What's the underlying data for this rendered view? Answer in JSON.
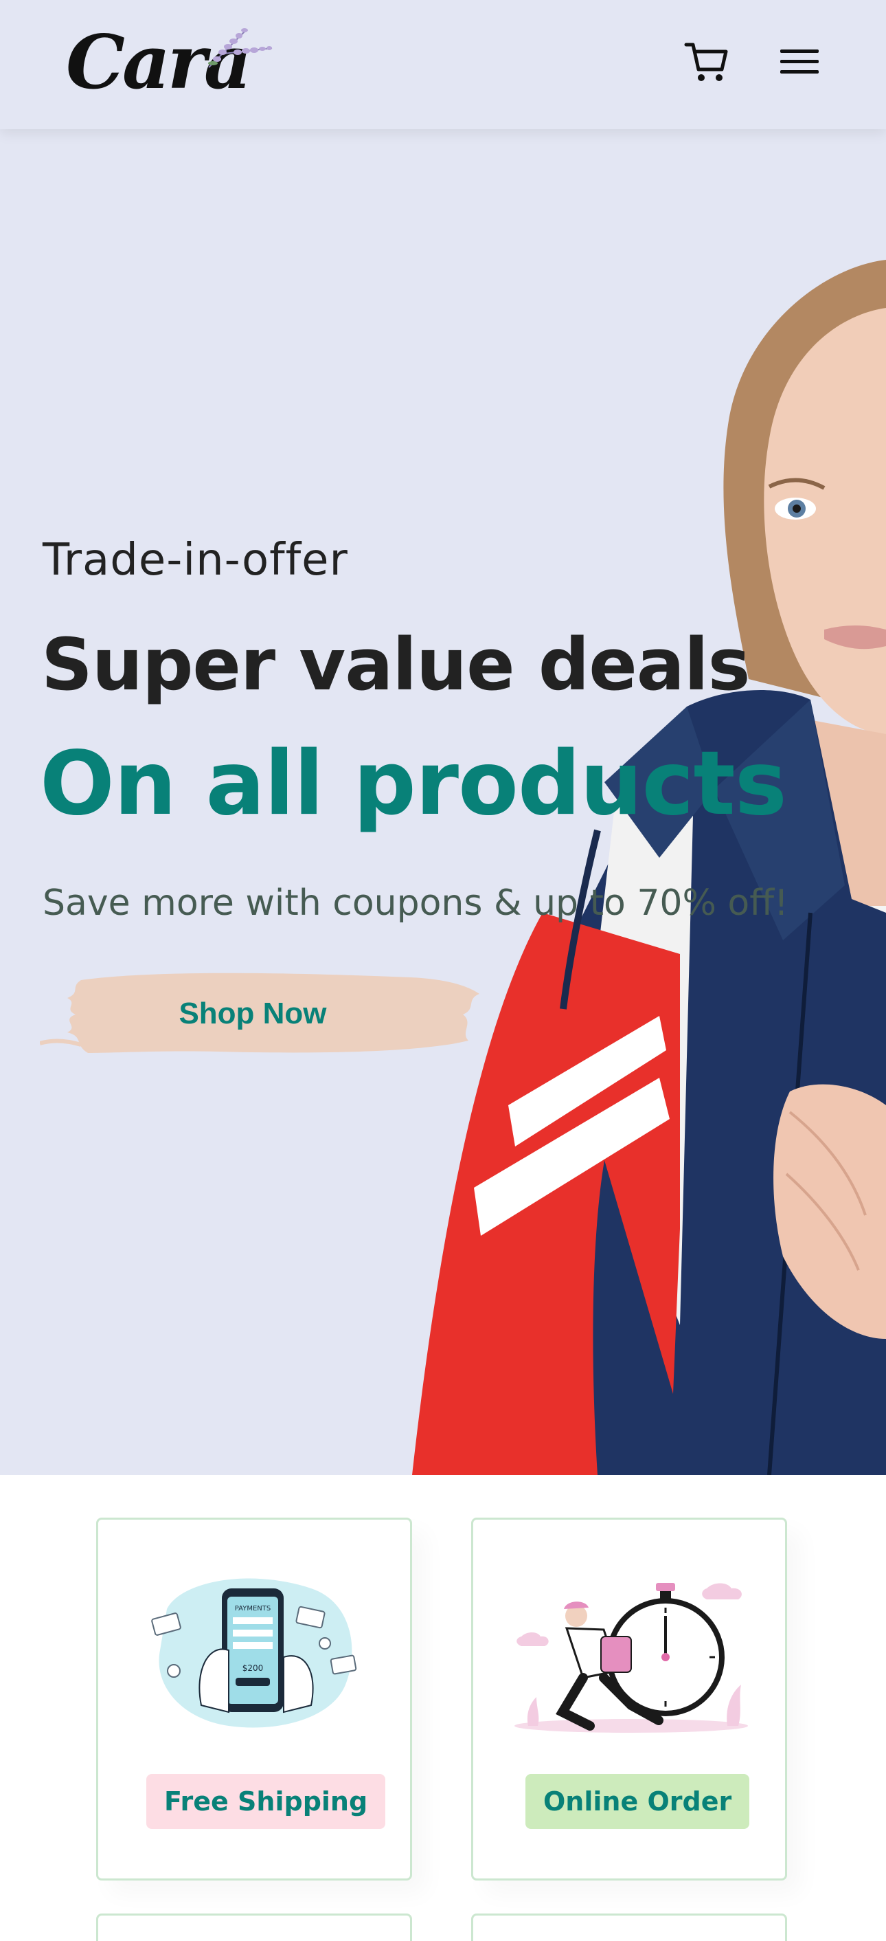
{
  "header": {
    "logo_text": "Cara",
    "cart_icon": "cart-icon",
    "menu_icon": "hamburger-menu-icon"
  },
  "hero": {
    "eyebrow": "Trade-in-offer",
    "headline": "Super value deals",
    "highlight": "On all products",
    "subtext": "Save more with coupons & up to 70% off!",
    "cta_label": "Shop Now"
  },
  "features": [
    {
      "label": "Free Shipping",
      "badge_color": "#fddde4",
      "illustration": "mobile-payment-illustration"
    },
    {
      "label": "Online Order",
      "badge_color": "#cdebbc",
      "illustration": "delivery-runner-clock-illustration"
    }
  ],
  "colors": {
    "brand": "#088178",
    "hero_bg": "#e3e6f3",
    "cta_brush": "#ecd0bf",
    "card_border": "#cce7d0"
  }
}
